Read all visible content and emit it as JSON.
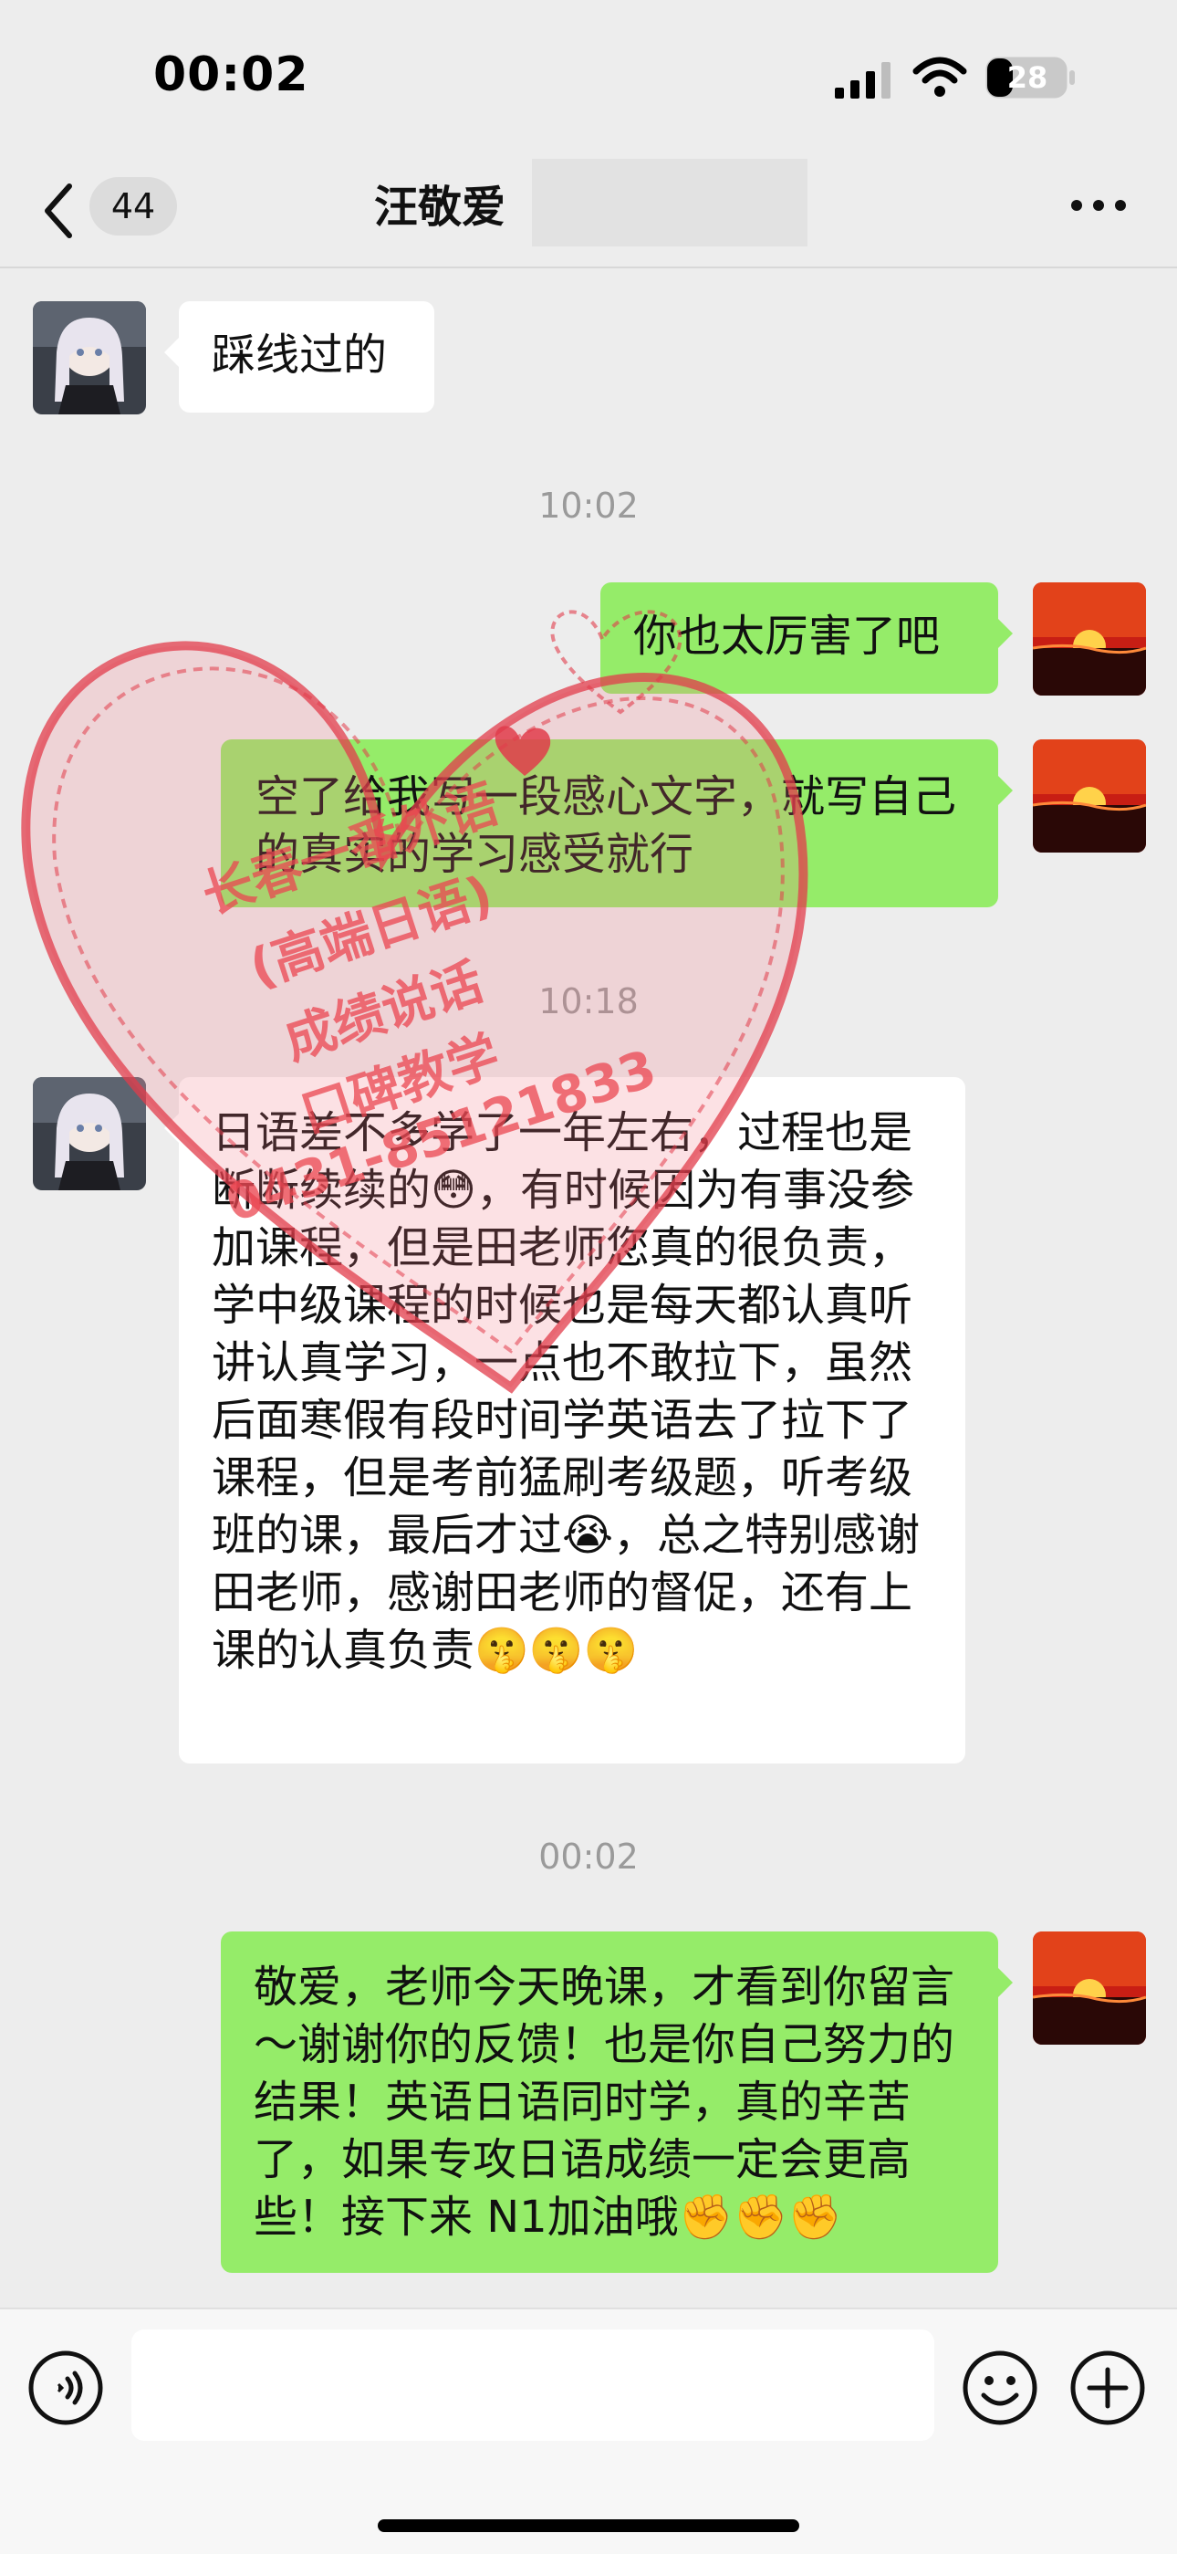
{
  "status_bar": {
    "time": "00:02",
    "battery_level": "28",
    "icons": [
      "signal-icon",
      "wifi-icon",
      "battery-icon"
    ]
  },
  "nav": {
    "back_icon": "chevron-left-icon",
    "unread_count": "44",
    "title": "汪敬爱",
    "more_icon": "more-icon"
  },
  "messages": [
    {
      "side": "in",
      "text": "踩线过的"
    },
    {
      "type": "time",
      "text": "10:02"
    },
    {
      "side": "out",
      "text": "你也太厉害了吧"
    },
    {
      "side": "out",
      "text": "空了给我写一段感心文字，就写自己的真实的学习感受就行"
    },
    {
      "type": "time",
      "text": "10:18"
    },
    {
      "side": "in",
      "text": "日语差不多学了一年左右，过程也是断断续续的😳，有时候因为有事没参加课程，但是田老师您真的很负责，学中级课程的时候也是每天都认真听讲认真学习，一点也不敢拉下，虽然后面寒假有段时间学英语去了拉下了课程，但是考前猛刷考级题，听考级班的课，最后才过😭，总之特别感谢田老师，感谢田老师的督促，还有上课的认真负责🤫🤫🤫"
    },
    {
      "type": "time",
      "text": "00:02"
    },
    {
      "side": "out",
      "text": "敬爱，老师今天晚课，才看到你留言～谢谢你的反馈！也是你自己努力的结果！英语日语同时学，真的辛苦了，如果专攻日语成绩一定会更高些！接下来 N1加油哦✊✊✊"
    }
  ],
  "watermark": {
    "lines": [
      "长春一番外语",
      "(高端日语)",
      "成绩说话",
      "口碑教学",
      "0431-85121833"
    ],
    "color": "#eb4650"
  },
  "input_bar": {
    "voice_icon": "voice-icon",
    "emoji_icon": "emoji-icon",
    "plus_icon": "plus-icon",
    "placeholder": ""
  },
  "colors": {
    "background": "#ededed",
    "outgoing_bubble": "#95ec69",
    "incoming_bubble": "#ffffff"
  }
}
